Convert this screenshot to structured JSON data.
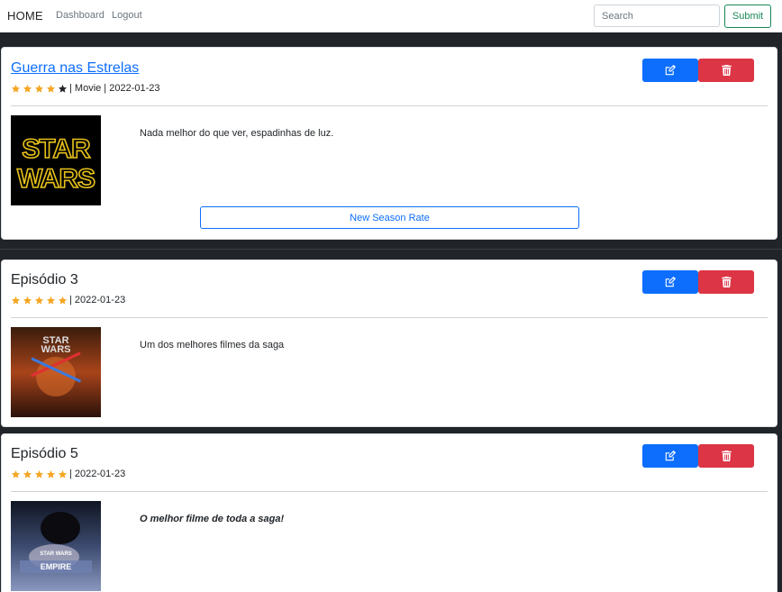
{
  "navbar": {
    "brand": "HOME",
    "links": [
      "Dashboard",
      "Logout"
    ],
    "search_placeholder": "Search",
    "submit_label": "Submit"
  },
  "colors": {
    "star_filled": "#f5a623",
    "star_empty": "#212529",
    "edit_button": "#0d6efd",
    "delete_button": "#dc3545",
    "link": "#0d6efd"
  },
  "cards": [
    {
      "title": "Guerra nas Estrelas",
      "rating": 4,
      "max_rating": 5,
      "meta": "| Movie | 2022-01-23",
      "description": "Nada melhor do que ver, espadinhas de luz.",
      "poster_text": [
        "STAR",
        "WARS"
      ],
      "action_label": "New Season Rate",
      "edit_icon": "edit-icon",
      "delete_icon": "trash-icon"
    },
    {
      "title": "Episódio 3",
      "rating": 5,
      "max_rating": 5,
      "meta": "| 2022-01-23",
      "description": "Um dos melhores filmes da saga",
      "poster_text": [
        "STAR",
        "WARS"
      ],
      "edit_icon": "edit-icon",
      "delete_icon": "trash-icon"
    },
    {
      "title": "Episódio 5",
      "rating": 5,
      "max_rating": 5,
      "meta": "| 2022-01-23",
      "description": "O melhor filme de toda a saga!",
      "poster_text": [
        "STAR WARS",
        "EMPIRE"
      ],
      "edit_icon": "edit-icon",
      "delete_icon": "trash-icon"
    }
  ]
}
